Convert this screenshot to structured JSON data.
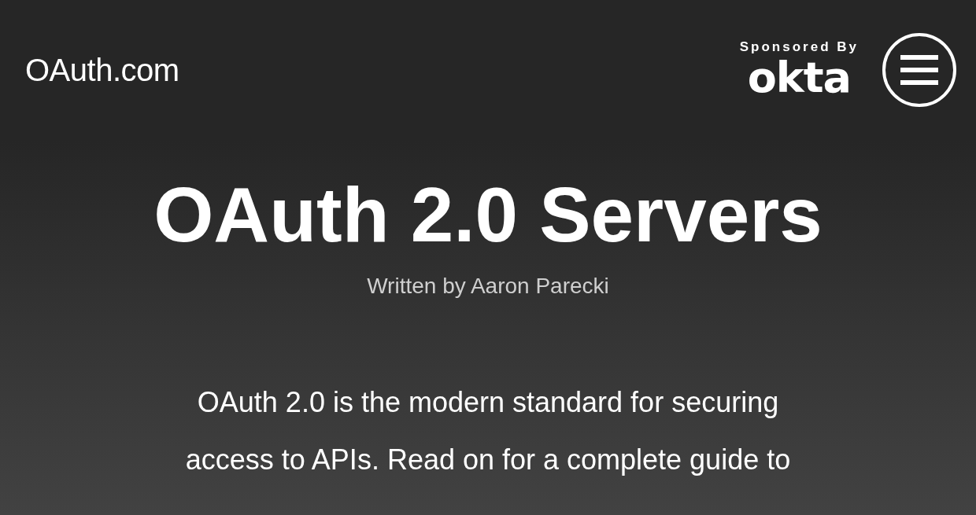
{
  "header": {
    "site_name": "OAuth.com",
    "sponsor_label": "Sponsored By",
    "sponsor_logo": "okta"
  },
  "hero": {
    "title": "OAuth 2.0 Servers",
    "byline": "Written by Aaron Parecki"
  },
  "intro": [
    "OAuth 2.0 is the modern standard for securing",
    "access to APIs. Read on for a complete guide to"
  ]
}
